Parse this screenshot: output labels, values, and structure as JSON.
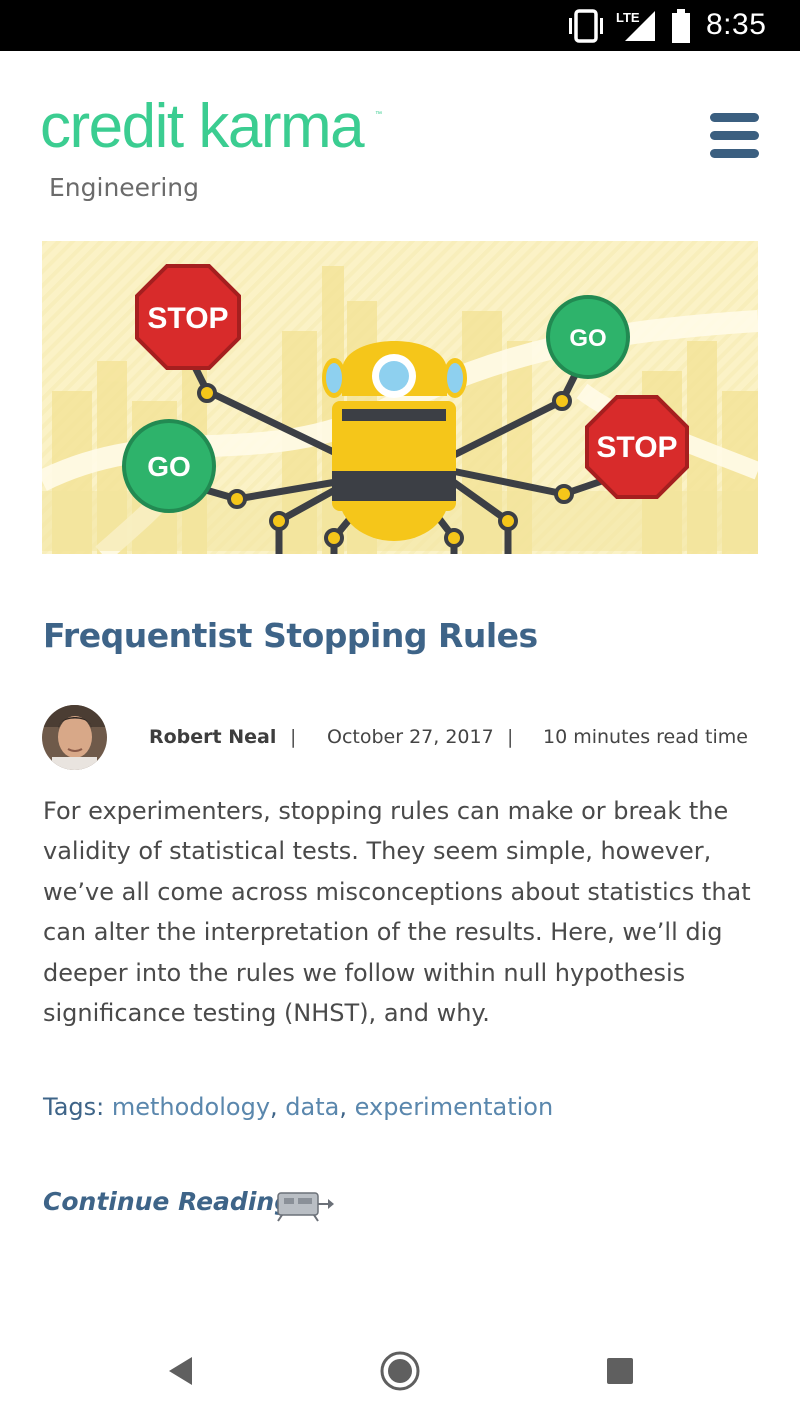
{
  "status_bar": {
    "network": "LTE",
    "time": "8:35",
    "icons": [
      "vibrate-icon",
      "signal-icon",
      "battery-icon"
    ]
  },
  "header": {
    "logo_text": "credit karma",
    "logo_tm": "™",
    "logo_sub": "Engineering",
    "menu_icon": "hamburger-menu-icon",
    "brand_color": "#3bcd91",
    "accent_color": "#3e6488"
  },
  "hero": {
    "signs": {
      "stop_1": "STOP",
      "go_1": "GO",
      "go_2": "GO",
      "stop_2": "STOP"
    }
  },
  "article": {
    "title": "Frequentist Stopping Rules",
    "author": "Robert Neal",
    "separator": "|",
    "date": "October 27, 2017",
    "read_time": "10 minutes read time",
    "excerpt": "For experimenters, stopping rules can make or break the validity of statistical tests. They seem simple, however, we’ve all come across misconceptions about statistics that can alter the interpretation of the results. Here, we’ll dig deeper into the rules we follow within null hypothesis significance testing (NHST), and why.",
    "tags_label": "Tags:",
    "tags": [
      "methodology",
      "data",
      "experimentation"
    ],
    "tag_separator": ",",
    "continue_label": "Continue Reading"
  },
  "nav_bar": {
    "icons": [
      "back-icon",
      "home-icon",
      "recents-icon"
    ]
  }
}
